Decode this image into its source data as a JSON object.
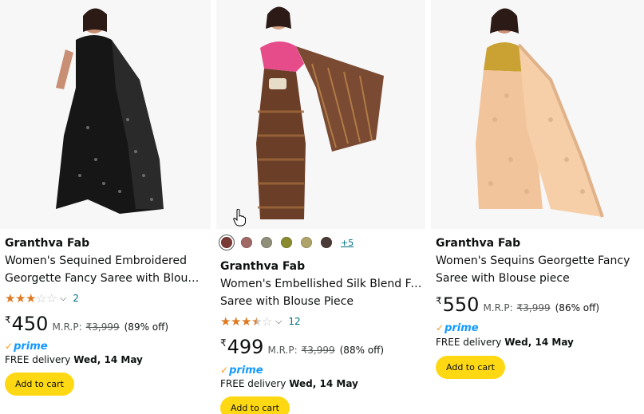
{
  "products": [
    {
      "brand": "Granthva Fab",
      "title_lines": [
        "Women's Sequined Embroidered",
        "Georgette Fancy Saree with Blouse…"
      ],
      "rating": 3,
      "rating_count": "2",
      "currency": "₹",
      "price": "450",
      "mrp_label": "M.R.P:",
      "mrp": "₹3,999",
      "discount": "(89% off)",
      "prime_label": "prime",
      "delivery_prefix": "FREE delivery",
      "delivery_date": "Wed, 14 May",
      "cart_label": "Add to cart",
      "saree_color": "#1a1a1a"
    },
    {
      "brand": "Granthva Fab",
      "title_lines": [
        "Women's Embellished Silk Blend Fancy",
        "Saree with Blouse Piece"
      ],
      "rating": 3.5,
      "rating_count": "12",
      "currency": "₹",
      "price": "499",
      "mrp_label": "M.R.P:",
      "mrp": "₹3,999",
      "discount": "(88% off)",
      "prime_label": "prime",
      "delivery_prefix": "FREE delivery",
      "delivery_date": "Wed, 14 May",
      "cart_label": "Add to cart",
      "swatch_colors": [
        "#7a3a35",
        "#a16a66",
        "#8f8f7a",
        "#8a8a2e",
        "#b0a36a",
        "#4a3b36"
      ],
      "swatch_more": "+5",
      "saree_color": "#6b3e28"
    },
    {
      "brand": "Granthva Fab",
      "title_lines": [
        "Women's Sequins Georgette Fancy",
        "Saree with Blouse piece"
      ],
      "rating": null,
      "currency": "₹",
      "price": "550",
      "mrp_label": "M.R.P:",
      "mrp": "₹3,999",
      "discount": "(86% off)",
      "prime_label": "prime",
      "delivery_prefix": "FREE delivery",
      "delivery_date": "Wed, 14 May",
      "cart_label": "Add to cart",
      "saree_color": "#f2c49b"
    }
  ],
  "colors": {
    "star": "#de7921",
    "link": "#007185",
    "prime_blue": "#1399ff",
    "prime_check": "#f79a1b",
    "cart_button": "#ffd814"
  }
}
